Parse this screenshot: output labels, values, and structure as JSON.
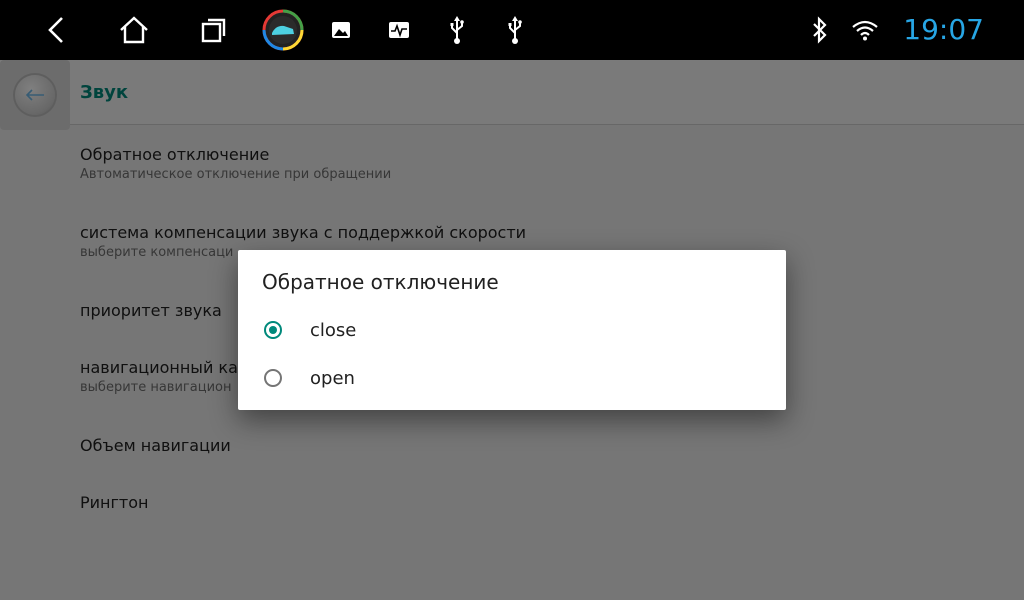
{
  "status_bar": {
    "time": "19:07",
    "time_color": "#27a6e5",
    "icons": [
      "back-icon",
      "home-icon",
      "recents-icon",
      "app-launcher-icon",
      "gallery-icon",
      "activity-icon",
      "usb-icon",
      "usb-icon",
      "bluetooth-icon",
      "wifi-icon"
    ]
  },
  "appbar": {
    "title": "Звук",
    "accent_color": "#00897b"
  },
  "settings": [
    {
      "title": "Обратное отключение",
      "subtitle": "Автоматическое отключение при обращении"
    },
    {
      "title": "система компенсации звука с поддержкой скорости",
      "subtitle": "выберите компенсаци"
    },
    {
      "title": "приоритет звука",
      "subtitle": ""
    },
    {
      "title": "навигационный ка",
      "subtitle": "выберите навигацион"
    },
    {
      "title": "Объем навигации",
      "subtitle": ""
    },
    {
      "title": "Рингтон",
      "subtitle": ""
    }
  ],
  "dialog": {
    "title": "Обратное отключение",
    "options": [
      {
        "label": "close",
        "selected": true
      },
      {
        "label": "open",
        "selected": false
      }
    ]
  }
}
